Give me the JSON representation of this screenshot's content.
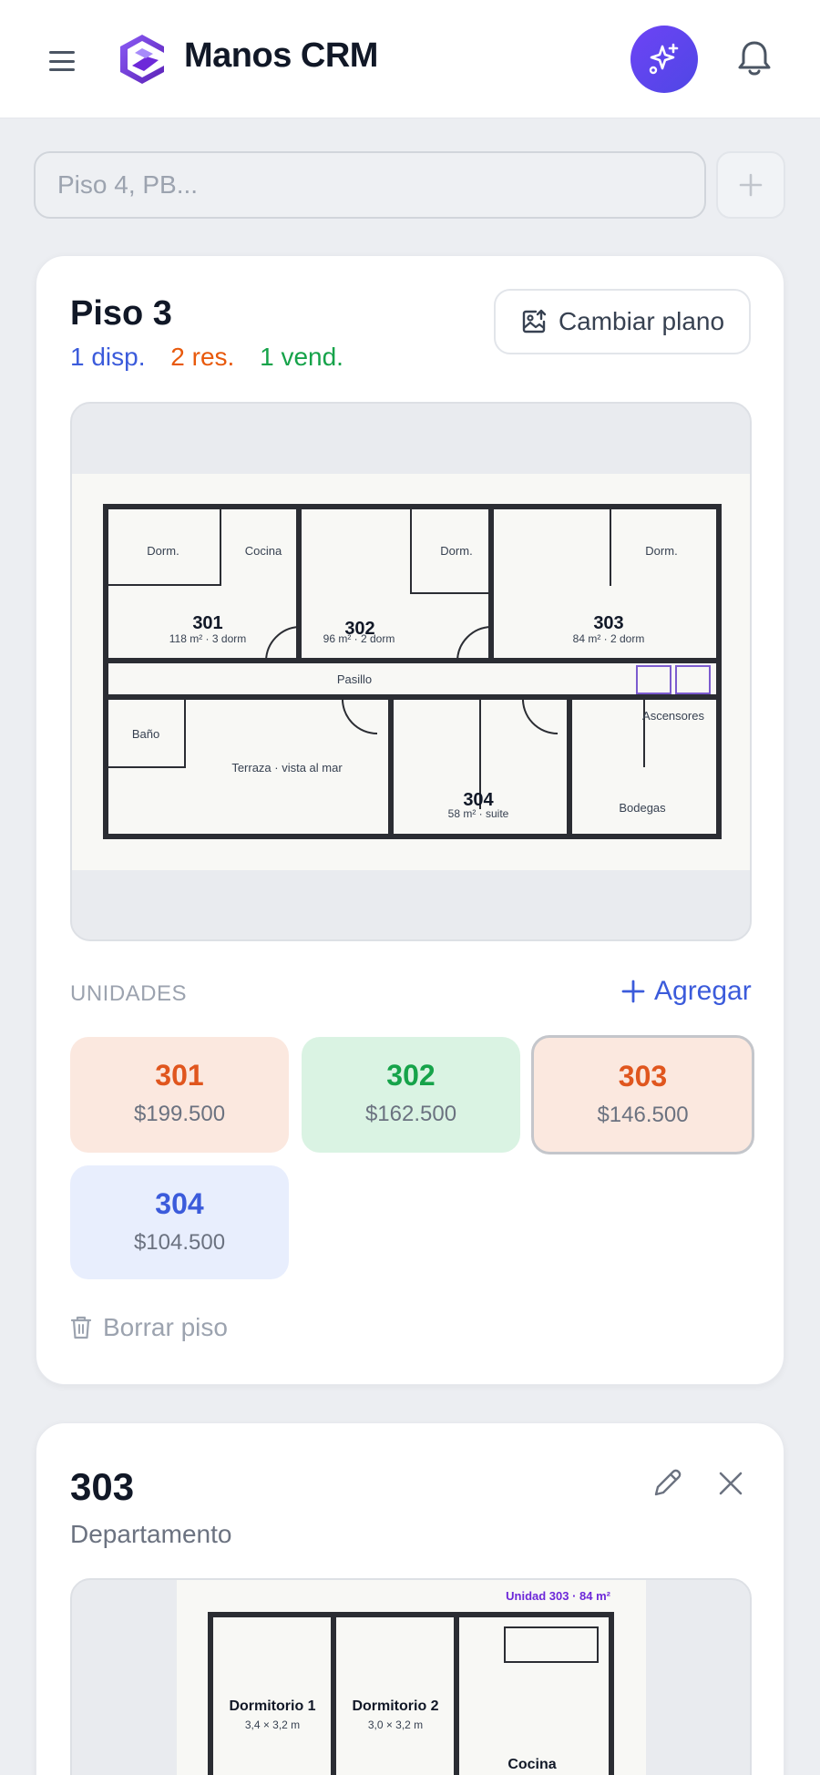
{
  "app": {
    "name": "Manos CRM",
    "colors": {
      "accent": "#4f46e5",
      "disponible": "#3b5bdb",
      "reservado": "#e8590c",
      "vendido": "#16a34a"
    }
  },
  "search": {
    "placeholder": "Piso 4, PB..."
  },
  "floor": {
    "title": "Piso 3",
    "stats": {
      "disp": "1 disp.",
      "res": "2 res.",
      "vend": "1 vend."
    },
    "change_plan_label": "Cambiar plano",
    "plan": {
      "u301": "301",
      "u301_meta": "118 m² · 3 dorm",
      "u302": "302",
      "u302_meta": "96 m² · 2 dorm",
      "u303": "303",
      "u303_meta": "84 m² · 2 dorm",
      "u304": "304",
      "u304_meta": "58 m² · suite",
      "dorm": "Dorm.",
      "cocina": "Cocina",
      "pasillo": "Pasillo",
      "ascensores": "Ascensores",
      "bano": "Baño",
      "terraza": "Terraza · vista al mar",
      "bodegas": "Bodegas"
    },
    "units_label": "UNIDADES",
    "add_label": "Agregar",
    "units": [
      {
        "number": "301",
        "price": "$199.500",
        "status": "reservado"
      },
      {
        "number": "302",
        "price": "$162.500",
        "status": "vendido"
      },
      {
        "number": "303",
        "price": "$146.500",
        "status": "reservado"
      },
      {
        "number": "304",
        "price": "$104.500",
        "status": "disponible"
      }
    ],
    "delete_label": "Borrar piso"
  },
  "unit_detail": {
    "title": "303",
    "type": "Departamento",
    "plan": {
      "header": "Unidad 303 · 84 m²",
      "room1": "Dormitorio 1",
      "room1_dim": "3,4 × 3,2 m",
      "room2": "Dormitorio 2",
      "room2_dim": "3,0 × 3,2 m",
      "room3": "Cocina"
    }
  }
}
